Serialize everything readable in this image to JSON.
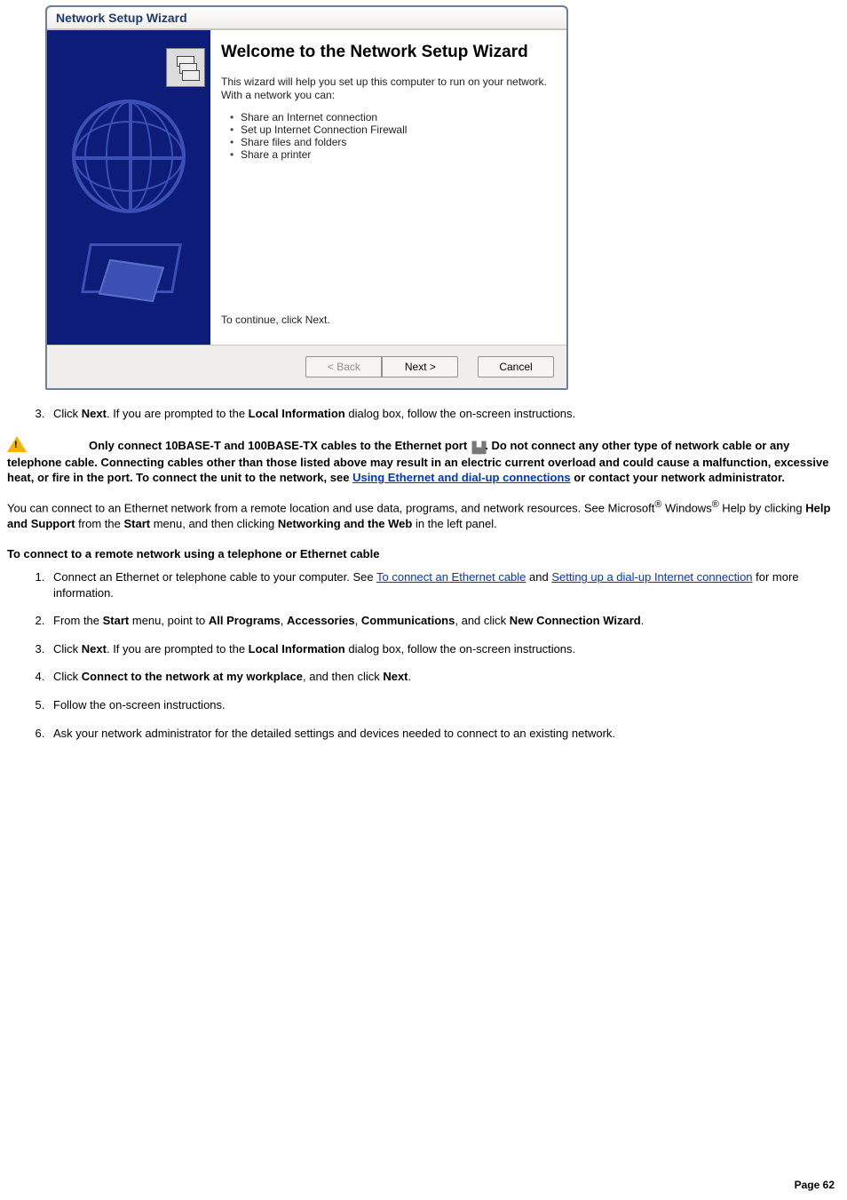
{
  "wizard": {
    "title": "Network Setup Wizard",
    "heading": "Welcome to the Network Setup Wizard",
    "intro": "This wizard will help you set up this computer to run on your network. With a network you can:",
    "bullets": [
      "Share an Internet connection",
      "Set up Internet Connection Firewall",
      "Share files and folders",
      "Share a printer"
    ],
    "continue": "To continue, click Next.",
    "buttons": {
      "back": "< Back",
      "next": "Next >",
      "cancel": "Cancel"
    }
  },
  "doc": {
    "step3_a": "Click ",
    "step3_bold": "Next",
    "step3_b": ". If you are prompted to the ",
    "step3_bold2": "Local Information",
    "step3_c": " dialog box, follow the on-screen instructions.",
    "warning_pre": "Only connect 10BASE-T and 100BASE-TX cables to the Ethernet port ",
    "warning_post": ". Do not connect any other type of network cable or any telephone cable. Connecting cables other than those listed above may result in an electric current overload and could cause a malfunction, excessive heat, or fire in the port. To connect the unit to the network, see ",
    "warning_link": "Using Ethernet and dial-up connections",
    "warning_tail": " or contact your network administrator.",
    "para_a": "You can connect to an Ethernet network from a remote location and use data, programs, and network resources. See Microsoft",
    "reg1": "®",
    "para_b": " Windows",
    "reg2": "®",
    "para_c": " Help by clicking ",
    "para_bold1": "Help and Support",
    "para_d": " from the ",
    "para_bold2": "Start",
    "para_e": " menu, and then clicking ",
    "para_bold3": "Networking and the Web",
    "para_f": " in the left panel.",
    "section_heading": "To connect to a remote network using a telephone or Ethernet cable",
    "ol2": {
      "i1_a": "Connect an Ethernet or telephone cable to your computer. See ",
      "i1_link1": "To connect an Ethernet cable",
      "i1_b": " and ",
      "i1_link2": "Setting up a dial-up Internet connection",
      "i1_c": " for more information.",
      "i2_a": "From the ",
      "i2_b1": "Start",
      "i2_b": " menu, point to ",
      "i2_b2": "All Programs",
      "i2_c": ", ",
      "i2_b3": "Accessories",
      "i2_d": ", ",
      "i2_b4": "Communications",
      "i2_e": ", and click ",
      "i2_b5": "New Connection Wizard",
      "i2_f": ".",
      "i3_a": "Click ",
      "i3_b1": "Next",
      "i3_b": ". If you are prompted to the ",
      "i3_b2": "Local Information",
      "i3_c": " dialog box, follow the on-screen instructions.",
      "i4_a": "Click ",
      "i4_b1": "Connect to the network at my workplace",
      "i4_b": ", and then click ",
      "i4_b2": "Next",
      "i4_c": ".",
      "i5": "Follow the on-screen instructions.",
      "i6": "Ask your network administrator for the detailed settings and devices needed to connect to an existing network."
    },
    "page_label": "Page 62"
  }
}
